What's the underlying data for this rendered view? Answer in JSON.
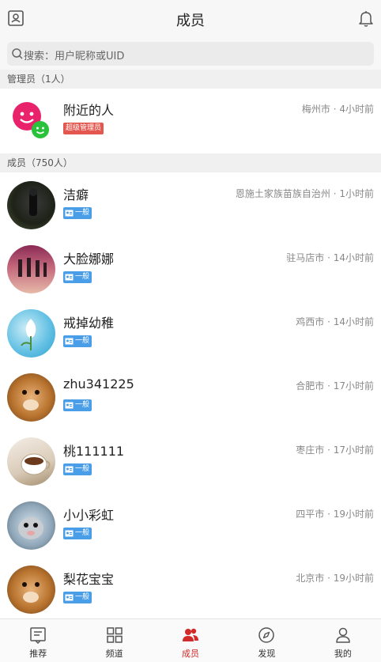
{
  "header": {
    "title": "成员"
  },
  "search": {
    "placeholder": "搜索：用户昵称或UID"
  },
  "admin_section": {
    "label": "管理员（1人）"
  },
  "member_section": {
    "label": "成员（750人）"
  },
  "admin": {
    "name": "附近的人",
    "badge": "超级管理员",
    "location": "梅州市 · 4小时前"
  },
  "members": [
    {
      "name": "洁癖",
      "badge": "一般",
      "location": "恩施土家族苗族自治州 · 1小时前"
    },
    {
      "name": "大脸娜娜",
      "badge": "一般",
      "location": "驻马店市 · 14小时前"
    },
    {
      "name": "戒掉幼稚",
      "badge": "一般",
      "location": "鸡西市 · 14小时前"
    },
    {
      "name": "zhu341225",
      "badge": "一般",
      "location": "合肥市 · 17小时前"
    },
    {
      "name": "桃111111",
      "badge": "一般",
      "location": "枣庄市 · 17小时前"
    },
    {
      "name": "小小彩虹",
      "badge": "一般",
      "location": "四平市 · 19小时前"
    },
    {
      "name": "梨花宝宝",
      "badge": "一般",
      "location": "北京市 · 19小时前"
    }
  ],
  "tabs": [
    {
      "label": "推荐",
      "icon": "recommend-icon"
    },
    {
      "label": "频道",
      "icon": "channel-grid-icon"
    },
    {
      "label": "成员",
      "icon": "members-icon"
    },
    {
      "label": "发现",
      "icon": "compass-icon"
    },
    {
      "label": "我的",
      "icon": "profile-icon"
    }
  ],
  "colors": {
    "accent": "#d12a2a",
    "admin_badge": "#e3574e",
    "member_badge": "#4a9ee8"
  }
}
